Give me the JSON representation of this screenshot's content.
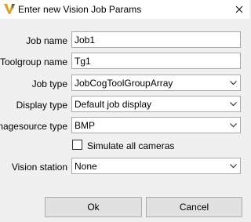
{
  "window": {
    "title": "Enter new Vision Job Params",
    "app_icon": "vision-logo-icon",
    "close_icon": "close-icon"
  },
  "form": {
    "job_name": {
      "label": "Job name",
      "value": "Job1"
    },
    "toolgroup_name": {
      "label": "Toolgroup name",
      "value": "Tg1"
    },
    "job_type": {
      "label": "Job type",
      "value": "JobCogToolGroupArray"
    },
    "display_type": {
      "label": "Display type",
      "value": "Default job display"
    },
    "imagesource_type": {
      "label": "Imagesource type",
      "value": "BMP"
    },
    "simulate_all_cameras": {
      "label": "Simulate all cameras",
      "checked": false
    },
    "vision_station": {
      "label": "Vision station",
      "value": "None"
    }
  },
  "buttons": {
    "ok": "Ok",
    "cancel": "Cancel"
  },
  "colors": {
    "logo_gold": "#e0a020",
    "logo_dark": "#5a5a5a"
  }
}
